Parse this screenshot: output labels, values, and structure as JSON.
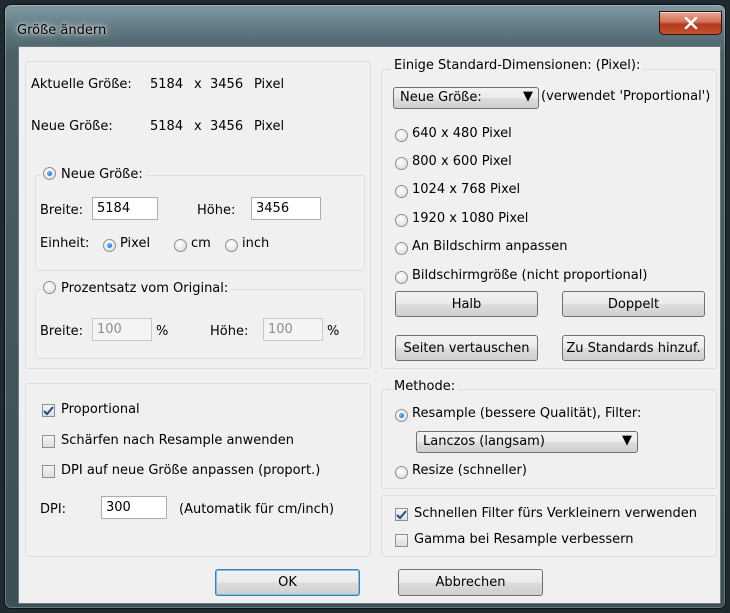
{
  "window": {
    "title": "Größe ändern"
  },
  "current": {
    "label": "Aktuelle Größe:",
    "width": "5184",
    "x": "x",
    "height": "3456",
    "unit": "Pixel"
  },
  "new": {
    "label": "Neue Größe:",
    "width": "5184",
    "x": "x",
    "height": "3456",
    "unit": "Pixel"
  },
  "size_group": {
    "legend": "Neue Größe:",
    "width_label": "Breite:",
    "width_value": "5184",
    "height_label": "Höhe:",
    "height_value": "3456",
    "unit_label": "Einheit:",
    "units": [
      "Pixel",
      "cm",
      "inch"
    ],
    "selected_unit": "Pixel"
  },
  "percent_group": {
    "legend": "Prozentsatz vom Original:",
    "width_label": "Breite:",
    "width_value": "100",
    "width_unit": "%",
    "height_label": "Höhe:",
    "height_value": "100",
    "height_unit": "%"
  },
  "options": {
    "proportional": "Proportional",
    "sharpen": "Schärfen nach Resample anwenden",
    "dpi_adjust": "DPI auf neue Größe anpassen (proport.)",
    "dpi_label": "DPI:",
    "dpi_value": "300",
    "dpi_hint": "(Automatik für cm/inch)"
  },
  "standard": {
    "legend": "Einige Standard-Dimensionen: (Pixel):",
    "combo_value": "Neue Größe:",
    "combo_hint": "(verwendet 'Proportional')",
    "presets": [
      "640 x 480 Pixel",
      "800 x 600 Pixel",
      "1024 x 768 Pixel",
      "1920 x 1080 Pixel",
      "An Bildschirm anpassen",
      "Bildschirmgröße (nicht proportional)"
    ],
    "half": "Halb",
    "double": "Doppelt",
    "swap": "Seiten vertauschen",
    "add": "Zu Standards hinzuf."
  },
  "method": {
    "legend": "Methode:",
    "resample": "Resample (bessere Qualität), Filter:",
    "filter_value": "Lanczos (langsam)",
    "resize": "Resize (schneller)"
  },
  "filter_opts": {
    "fast_filter": "Schnellen Filter fürs Verkleinern verwenden",
    "gamma": "Gamma bei Resample verbessern"
  },
  "footer": {
    "ok": "OK",
    "cancel": "Abbrechen"
  },
  "colors": {
    "close_button": "#c5532f",
    "radio_dot": "#0f56b8",
    "check_mark": "#1c4e8c"
  }
}
